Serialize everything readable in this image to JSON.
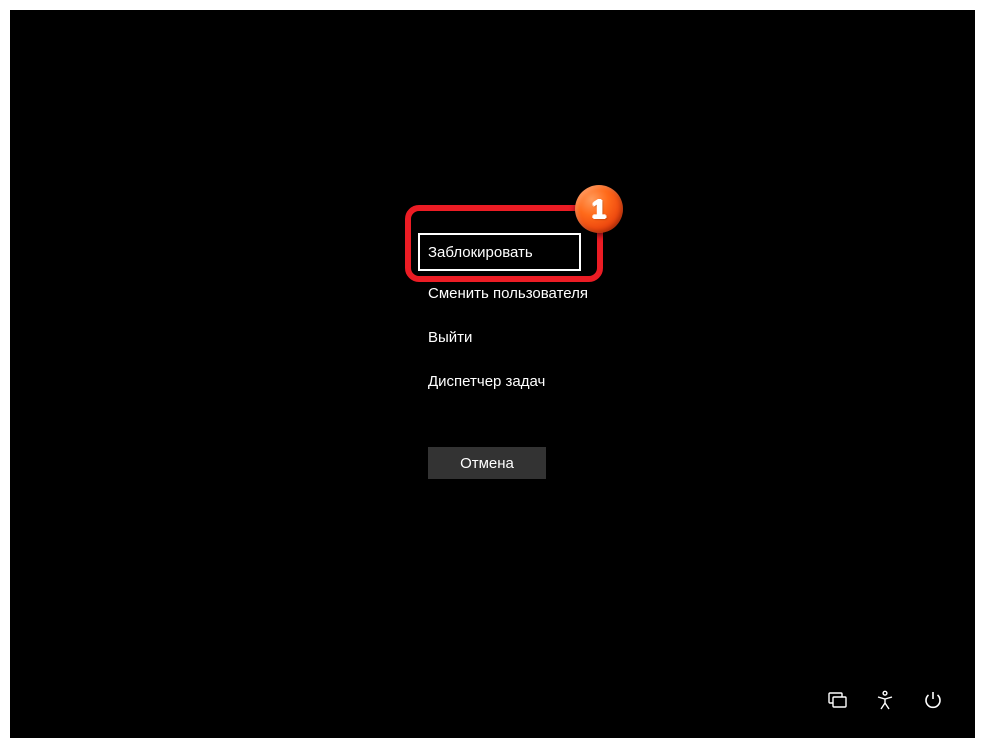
{
  "options": {
    "lock": "Заблокировать",
    "switch_user": "Сменить пользователя",
    "sign_out": "Выйти",
    "task_manager": "Диспетчер задач"
  },
  "cancel_label": "Отмена",
  "annotation": {
    "number": "1"
  }
}
